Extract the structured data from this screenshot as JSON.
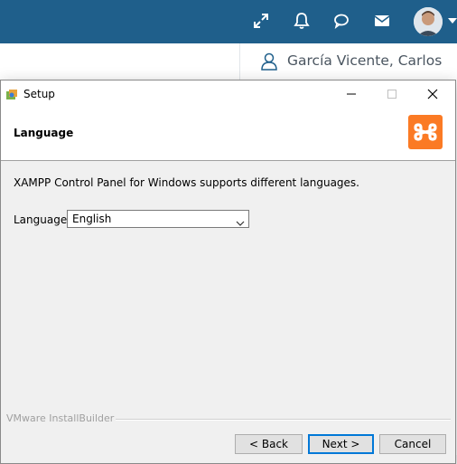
{
  "background_app": {
    "topbar_color": "#1f5f8b",
    "icons": [
      "expand-arrows-icon",
      "bell-icon",
      "chat-bubble-icon",
      "envelope-icon"
    ],
    "user": {
      "name": "García Vicente, Carlos"
    }
  },
  "setup": {
    "window_title": "Setup",
    "heading": "Language",
    "description": "XAMPP Control Panel for Windows supports different languages.",
    "language_label": "Language",
    "language_selected": "English",
    "branding": "VMware InstallBuilder",
    "buttons": {
      "back": "< Back",
      "next": "Next >",
      "cancel": "Cancel"
    },
    "colors": {
      "logo_orange": "#fb7a24",
      "focus_blue": "#0078d7"
    }
  }
}
